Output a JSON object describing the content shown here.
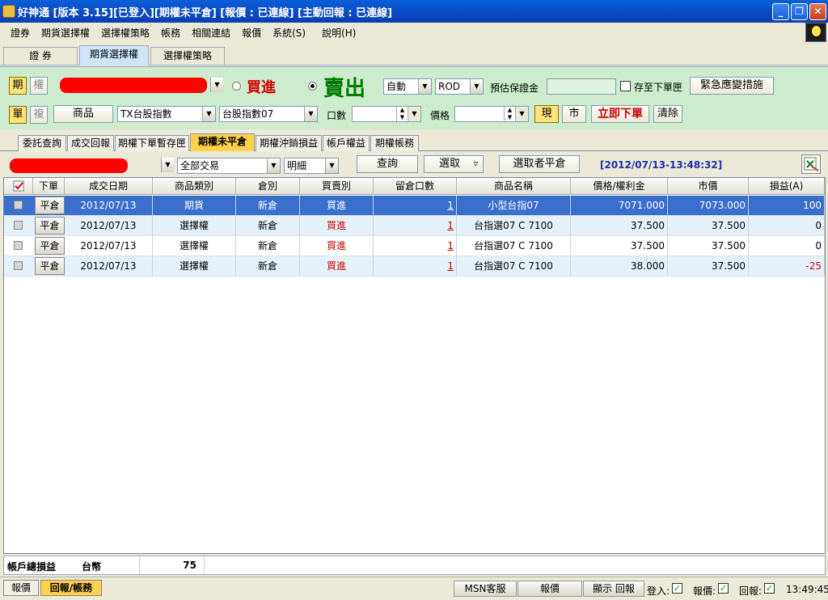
{
  "window": {
    "title": "好神通 [版本 3.15][已登入][期權未平倉] [報價 : 已連線] [主動回報 : 已連線]"
  },
  "menu": [
    "證券",
    "期貨選擇權",
    "選擇權策略",
    "帳務",
    "相關連結",
    "報價",
    "系統(S)",
    "說明(H)"
  ],
  "top_tabs": [
    {
      "label": "證  券"
    },
    {
      "label": "期貨選擇權",
      "active": true
    },
    {
      "label": "選擇權策略"
    }
  ],
  "order": {
    "futures_btn": "期",
    "options_btn": "權",
    "single_btn": "單",
    "combo_btn": "複",
    "buy_label": "買進",
    "sell_label": "賣出",
    "side_selected": "sell",
    "price_mode": "自動",
    "order_type": "ROD",
    "margin_label": "預估保證金",
    "margin_value": "",
    "save_label": "存至下單匣",
    "emergency_btn": "緊急應變措施",
    "product_btn": "商品",
    "product_select": "TX台股指數",
    "contract_select": "台股指數07",
    "qty_label": "口數",
    "price_label": "價格",
    "spot_btn": "現",
    "market_btn": "市",
    "submit_btn": "立即下單",
    "clear_btn": "清除"
  },
  "sub_tabs": [
    {
      "label": "委託查詢"
    },
    {
      "label": "成交回報"
    },
    {
      "label": "期權下單暫存匣"
    },
    {
      "label": "期權未平倉",
      "active": true
    },
    {
      "label": "期權沖銷損益"
    },
    {
      "label": "帳戶權益"
    },
    {
      "label": "期權帳務"
    }
  ],
  "filter": {
    "trade_type": "全部交易",
    "detail": "明細",
    "query_btn": "查詢",
    "select_btn": "選取",
    "select_arrow": "▿",
    "close_selected_btn": "選取者平倉",
    "timestamp": "[2012/07/13-13:48:32]"
  },
  "table": {
    "headers": [
      "",
      "下單",
      "成交日期",
      "商品類別",
      "倉別",
      "買賣別",
      "留倉口數",
      "商品名稱",
      "價格/權利金",
      "市價",
      "損益(A)"
    ],
    "close_label": "平倉",
    "rows": [
      {
        "date": "2012/07/13",
        "category": "期貨",
        "position": "新倉",
        "side": "買進",
        "qty": "1",
        "name": "小型台指07",
        "price": "7071.000",
        "market": "7073.000",
        "pnl": "100",
        "selected": true
      },
      {
        "date": "2012/07/13",
        "category": "選擇權",
        "position": "新倉",
        "side": "買進",
        "qty": "1",
        "name": "台指選07 C 7100",
        "price": "37.500",
        "market": "37.500",
        "pnl": "0"
      },
      {
        "date": "2012/07/13",
        "category": "選擇權",
        "position": "新倉",
        "side": "買進",
        "qty": "1",
        "name": "台指選07 C 7100",
        "price": "37.500",
        "market": "37.500",
        "pnl": "0"
      },
      {
        "date": "2012/07/13",
        "category": "選擇權",
        "position": "新倉",
        "side": "買進",
        "qty": "1",
        "name": "台指選07 C 7100",
        "price": "38.000",
        "market": "37.500",
        "pnl": "-25"
      }
    ]
  },
  "summary": {
    "label": "帳戶總損益",
    "currency": "台幣",
    "value": "75"
  },
  "status": {
    "tab_quote": "報價",
    "tab_report": "回報/帳務",
    "msn_btn": "MSN客服",
    "quote_btn": "報價",
    "show_report_btn": "顯示 回報",
    "login_label": "登入:",
    "quote_label": "報價:",
    "report_label": "回報:",
    "check_mark": "✓",
    "time": "13:49:45"
  },
  "colors": {
    "buy": "#d00000",
    "sell": "#007a00",
    "selected_row": "#3a6fcd",
    "timestamp": "#1a2fb0"
  }
}
